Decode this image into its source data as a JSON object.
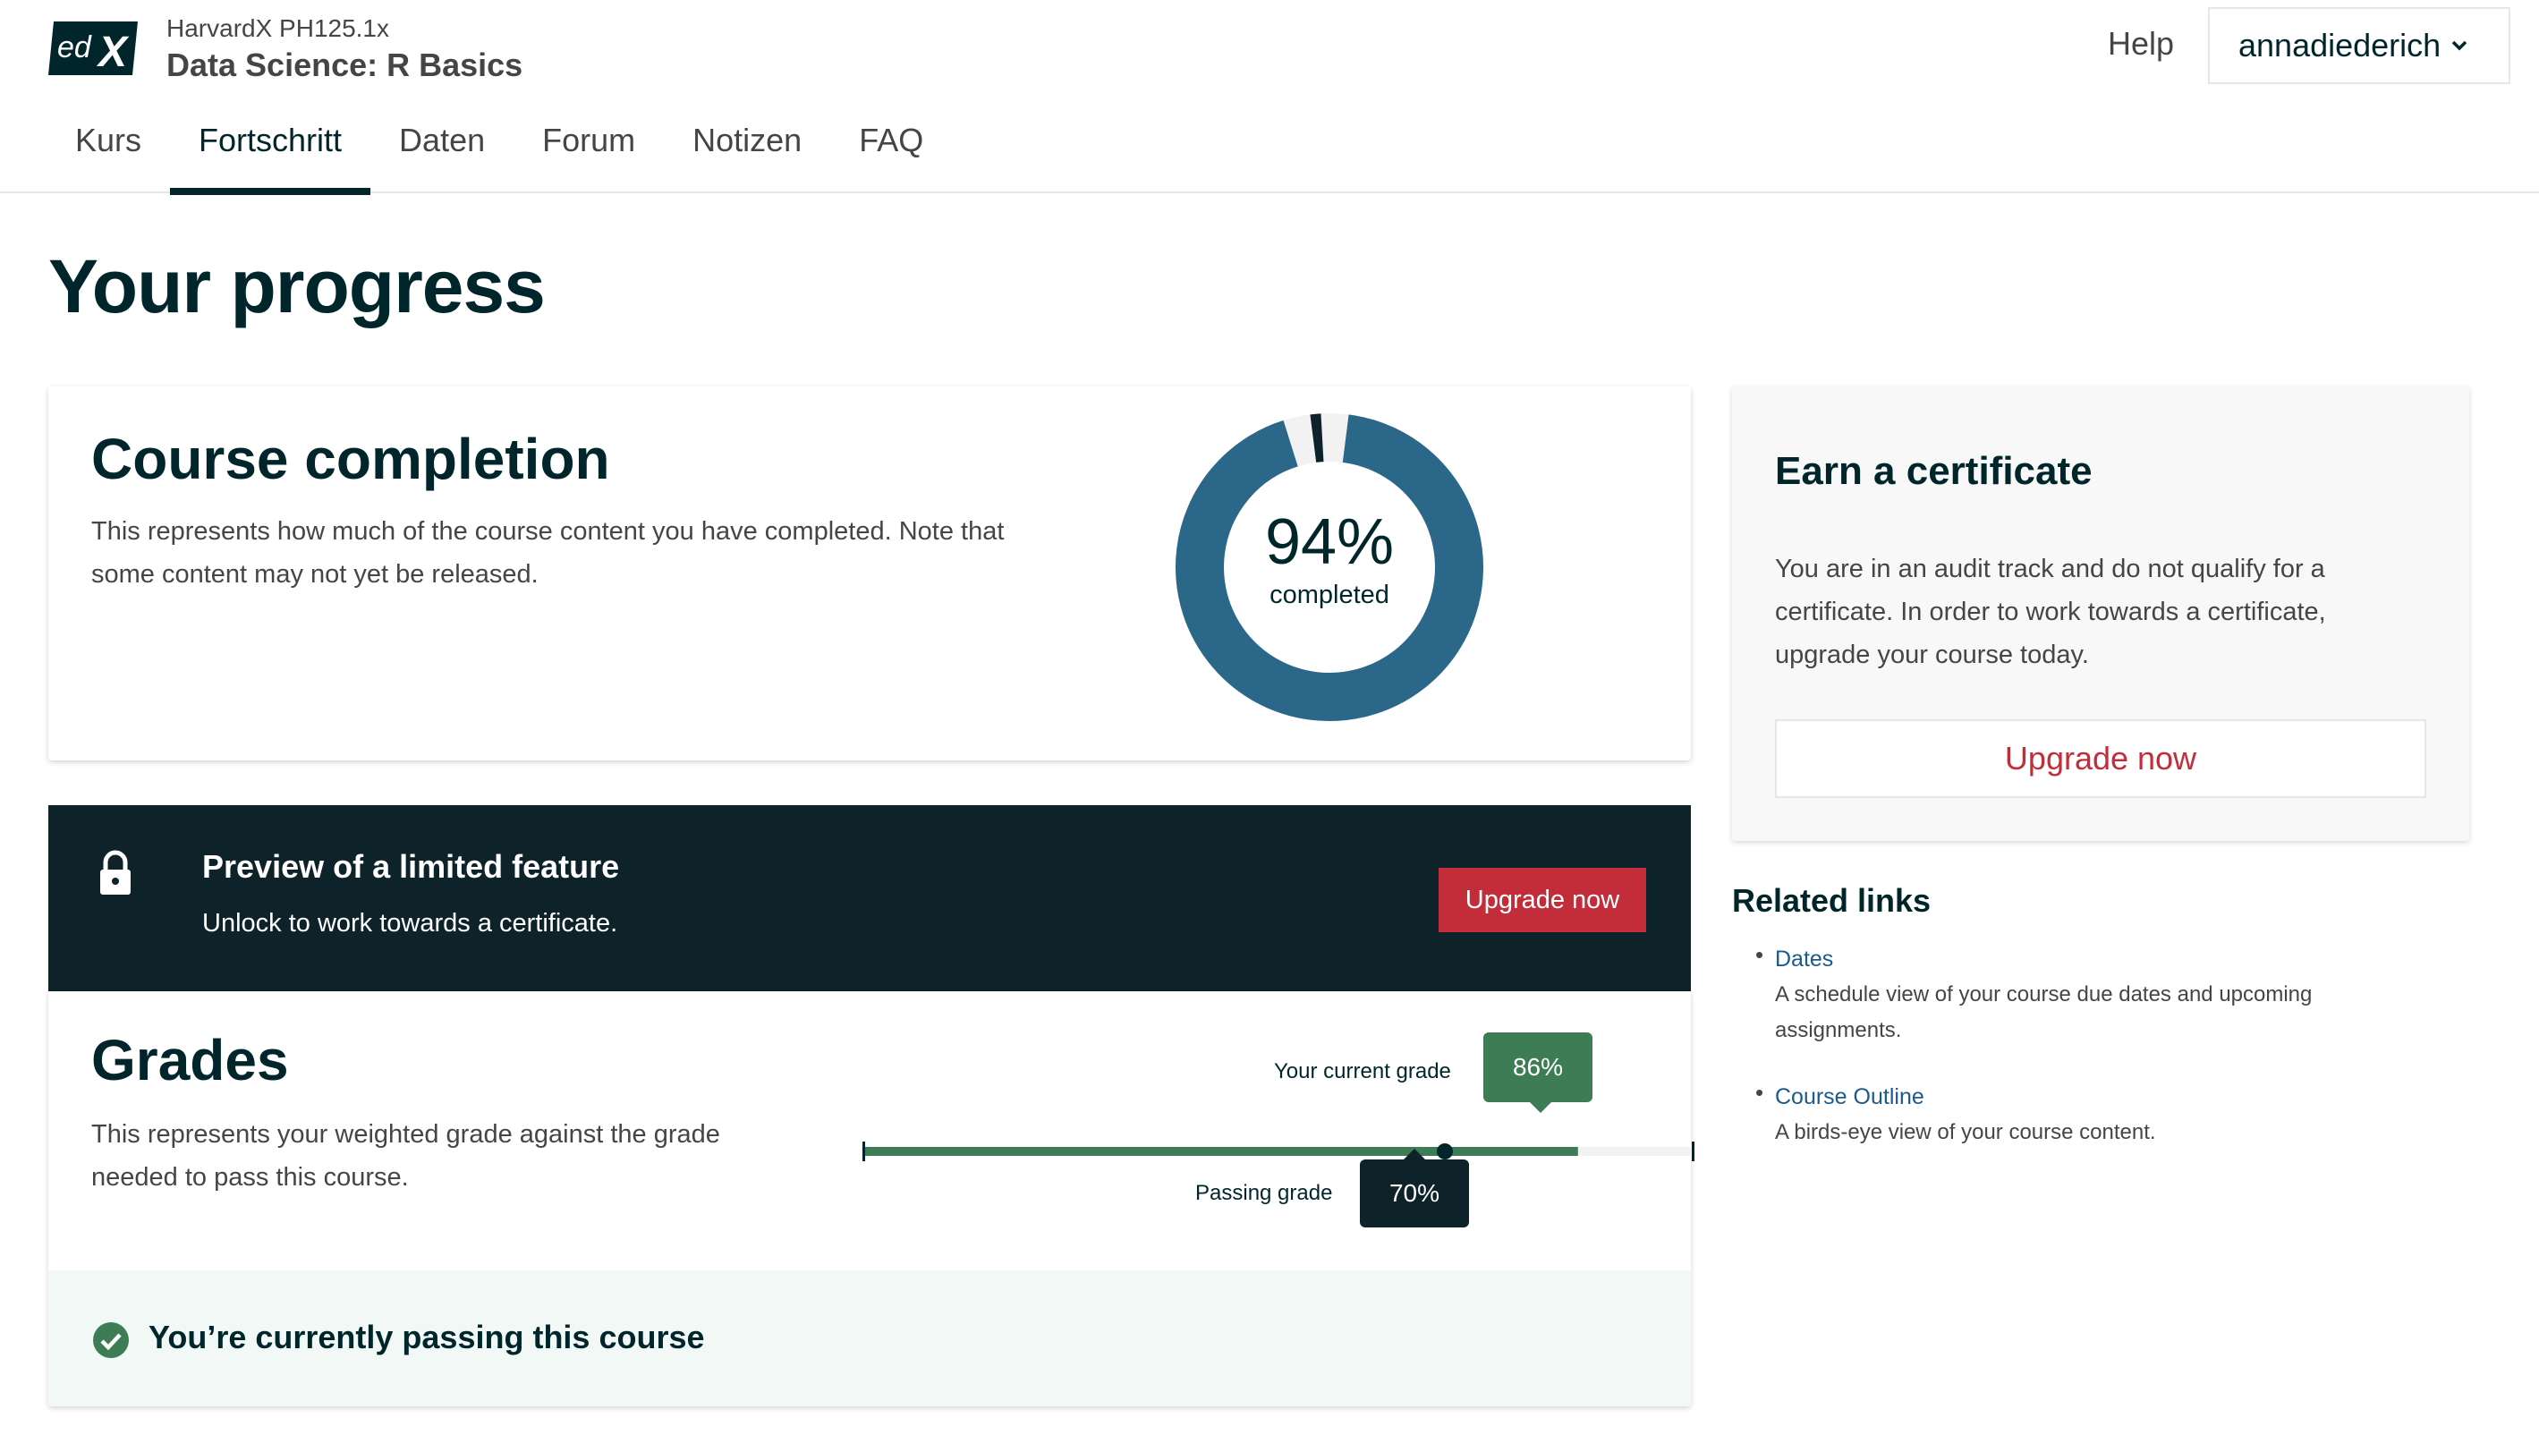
{
  "header": {
    "logo_text": "edX",
    "course_org": "HarvardX PH125.1x",
    "course_title": "Data Science: R Basics",
    "help": "Help",
    "username": "annadiederich"
  },
  "tabs": [
    {
      "label": "Kurs",
      "active": false
    },
    {
      "label": "Fortschritt",
      "active": true
    },
    {
      "label": "Daten",
      "active": false
    },
    {
      "label": "Forum",
      "active": false
    },
    {
      "label": "Notizen",
      "active": false
    },
    {
      "label": "FAQ",
      "active": false
    }
  ],
  "page_title": "Your progress",
  "completion": {
    "title": "Course completion",
    "description": "This represents how much of the course content you have completed. Note that some content may not yet be released.",
    "percent_label": "94%",
    "percent_caption": "completed",
    "complete_fraction": 0.94,
    "locked_fraction": 0.02
  },
  "locked_feature": {
    "title": "Preview of a limited feature",
    "subtitle": "Unlock to work towards a certificate.",
    "button": "Upgrade now"
  },
  "grades": {
    "title": "Grades",
    "description": "This represents your weighted grade against the grade needed to pass this course.",
    "current_label": "Your current grade",
    "current_value": "86%",
    "current_fraction": 0.86,
    "passing_label": "Passing grade",
    "passing_value": "70%",
    "passing_fraction": 0.7,
    "status": "You’re currently passing this course"
  },
  "certificate": {
    "title": "Earn a certificate",
    "text": "You are in an audit track and do not qualify for a certificate. In order to work towards a certificate, upgrade your course today.",
    "button": "Upgrade now"
  },
  "related": {
    "title": "Related links",
    "items": [
      {
        "label": "Dates",
        "description": "A schedule view of your course due dates and upcoming assignments."
      },
      {
        "label": "Course Outline",
        "description": "A birds-eye view of your course content."
      }
    ]
  },
  "colors": {
    "primary_dark": "#00262b",
    "donut_complete": "#2a6789",
    "donut_locked": "#0e2329",
    "grade_green": "#3d7c54",
    "brand_red": "#c32d3a"
  }
}
